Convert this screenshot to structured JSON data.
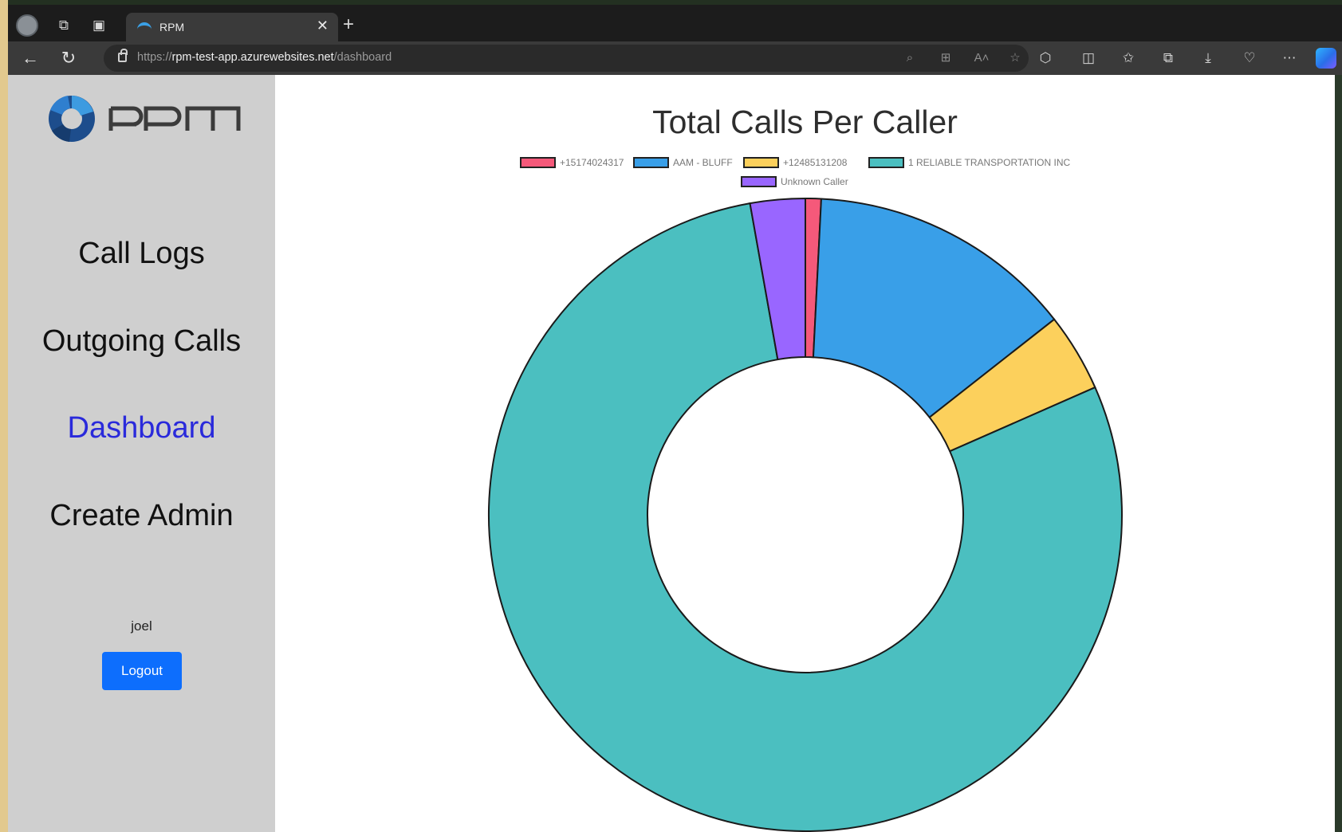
{
  "browser": {
    "tab_title": "RPM",
    "url_scheme": "https://",
    "url_host": "rpm-test-app.azurewebsites.net",
    "url_path": "/dashboard"
  },
  "sidebar": {
    "logo_text": "RPM",
    "nav": [
      {
        "label": "Call Logs"
      },
      {
        "label": "Outgoing Calls"
      },
      {
        "label": "Dashboard",
        "active": true
      },
      {
        "label": "Create Admin"
      }
    ],
    "username": "joel",
    "logout_label": "Logout"
  },
  "colors": {
    "active_nav": "#2a2adb",
    "logout_button": "#0d6efd",
    "sidebar_bg": "#cfcfcf"
  },
  "chart_data": {
    "type": "doughnut",
    "title": "Total Calls Per Caller",
    "legend_position": "top",
    "categories": [
      "+15174024317",
      "AAM - BLUFF",
      "+12485131208",
      "1 RELIABLE TRANSPORTATION INC",
      "Unknown Caller"
    ],
    "values": [
      0.8,
      13.6,
      4.0,
      78.8,
      2.8
    ],
    "colors": [
      "#f5597a",
      "#399fe8",
      "#fcd05c",
      "#4bbfc0",
      "#9966ff"
    ]
  }
}
